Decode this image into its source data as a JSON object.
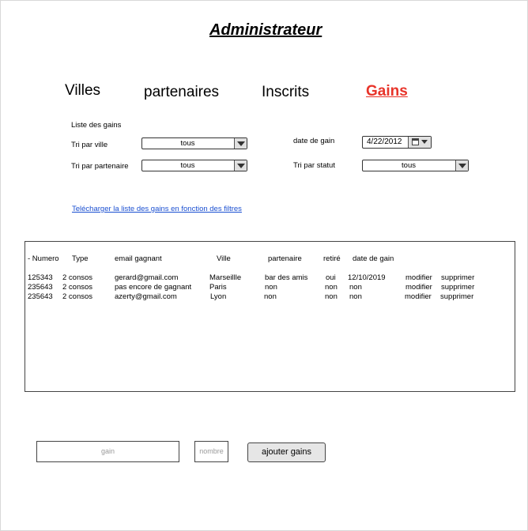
{
  "title": "Administrateur",
  "nav": {
    "items": [
      "Villes",
      "partenaires",
      "Inscrits",
      "Gains"
    ],
    "active": "Gains"
  },
  "filters": {
    "list_title": "Liste des gains",
    "tri_ville_label": "Tri par ville",
    "tri_ville_value": "tous",
    "tri_partenaire_label": "Tri par partenaire",
    "tri_partenaire_value": "tous",
    "date_gain_label": "date de gain",
    "date_gain_value": "4/22/2012",
    "tri_statut_label": "Tri par statut",
    "tri_statut_value": "tous"
  },
  "download_link": "Telécharger la liste des gains en fonction des filtres",
  "table": {
    "headers": [
      "- Numero",
      "Type",
      "email gagnant",
      "Ville",
      "partenaire",
      "retiré",
      "date de gain"
    ],
    "rows": [
      [
        "125343",
        "2 consos",
        "gerard@gmail.com",
        "Marseillle",
        "bar des amis",
        "oui",
        "12/10/2019",
        "modifier",
        "supprimer"
      ],
      [
        "235643",
        "2 consos",
        "pas encore de gagnant",
        "Paris",
        "non",
        "non",
        "non",
        "modifier",
        "supprimer"
      ],
      [
        "235643",
        "2 consos",
        "azerty@gmail.com",
        "Lyon",
        "non",
        "non",
        "non",
        "modifier",
        "supprimer"
      ]
    ]
  },
  "form": {
    "gain_placeholder": "gain",
    "nombre_placeholder": "nombre",
    "add_button": "ajouter gains"
  },
  "icons": {
    "select_arrow": "chevron-down-icon",
    "date_picker": "calendar-icon"
  },
  "colors": {
    "active_tab": "#e8342a",
    "link": "#1a4fd1"
  }
}
